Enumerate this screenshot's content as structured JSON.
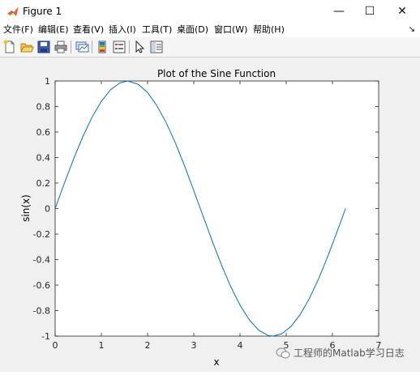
{
  "window": {
    "title": "Figure 1",
    "minimize_glyph": "—",
    "maximize_glyph": "☐",
    "close_glyph": "✕"
  },
  "menu": {
    "items": [
      "文件(F)",
      "编辑(E)",
      "查看(V)",
      "插入(I)",
      "工具(T)",
      "桌面(D)",
      "窗口(W)",
      "帮助(H)"
    ],
    "corner_glyph": "↘"
  },
  "toolbar": {
    "icons": [
      "new-figure-icon",
      "open-file-icon",
      "save-icon",
      "print-icon",
      "link-plot-icon",
      "insert-colorbar-icon",
      "insert-legend-icon",
      "pointer-icon",
      "property-editor-icon"
    ]
  },
  "colors": {
    "line": "#0072BD",
    "figure_bg": "#f0f0f0",
    "axes_bg": "#ffffff"
  },
  "chart_data": {
    "type": "line",
    "title": "Plot of the Sine Function",
    "xlabel": "x",
    "ylabel": "sin(x)",
    "xlim": [
      0,
      7
    ],
    "ylim": [
      -1,
      1
    ],
    "xticks": [
      "0",
      "1",
      "2",
      "3",
      "4",
      "5",
      "6",
      "7"
    ],
    "yticks": [
      "-1",
      "-0.8",
      "-0.6",
      "-0.4",
      "-0.2",
      "0",
      "0.2",
      "0.4",
      "0.6",
      "0.8",
      "1"
    ],
    "grid": false,
    "series": [
      {
        "function": "sin(x)",
        "x": [
          0,
          0.2,
          0.4,
          0.6,
          0.8,
          1.0,
          1.2,
          1.4,
          1.5708,
          1.8,
          2.0,
          2.2,
          2.4,
          2.6,
          2.8,
          3.0,
          3.1416,
          3.4,
          3.6,
          3.8,
          4.0,
          4.2,
          4.4,
          4.6,
          4.7124,
          4.9,
          5.1,
          5.3,
          5.5,
          5.7,
          5.9,
          6.1,
          6.2832
        ],
        "y": [
          0,
          0.199,
          0.389,
          0.565,
          0.717,
          0.841,
          0.932,
          0.985,
          1.0,
          0.974,
          0.909,
          0.808,
          0.675,
          0.516,
          0.335,
          0.141,
          0,
          -0.256,
          -0.443,
          -0.612,
          -0.757,
          -0.872,
          -0.952,
          -0.994,
          -1.0,
          -0.982,
          -0.926,
          -0.832,
          -0.706,
          -0.551,
          -0.374,
          -0.182,
          0
        ]
      }
    ]
  },
  "watermark": {
    "text": "工程师的Matlab学习日志"
  }
}
